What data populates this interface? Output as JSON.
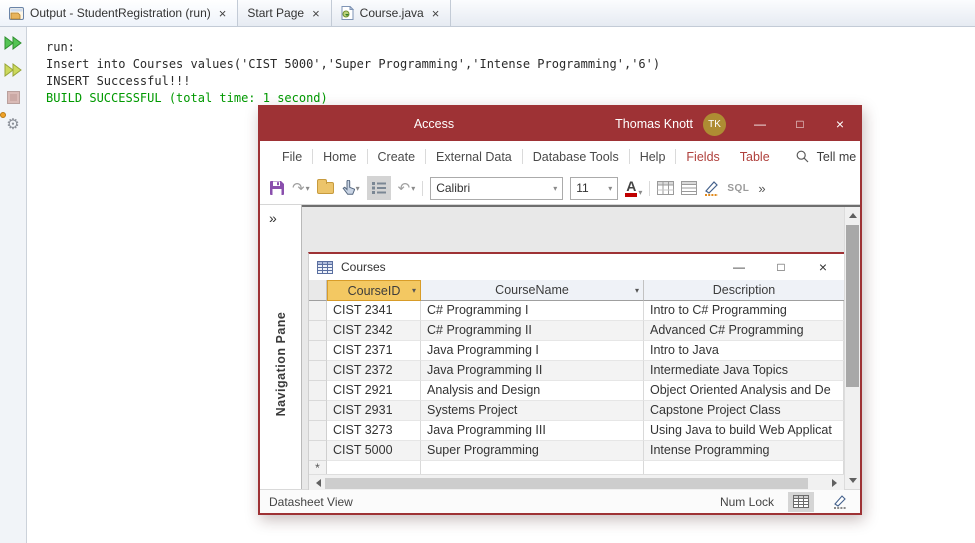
{
  "glyphs": {
    "tab_close": "×",
    "minimize": "—",
    "maximize": "□",
    "close": "×",
    "caret": "▾",
    "expand": "»",
    "more": "»",
    "redo": "↷",
    "undo": "↶",
    "gear": "⚙",
    "new_record": "*"
  },
  "netbeans": {
    "tabs": [
      {
        "label": "Output - StudentRegistration (run)"
      },
      {
        "label": "Start Page"
      },
      {
        "label": "Course.java"
      }
    ],
    "console": {
      "lines": [
        {
          "text": "run:"
        },
        {
          "text": "Insert into Courses values('CIST 5000','Super Programming','Intense Programming','6')"
        },
        {
          "text": "INSERT Successful!!!"
        },
        {
          "text": "BUILD SUCCESSFUL (total time: 1 second)"
        }
      ],
      "success_color": "#009900"
    }
  },
  "access": {
    "brand_color": "#9E3235",
    "titlebar": {
      "app_title": "Access",
      "user_name": "Thomas Knott",
      "avatar_initials": "TK"
    },
    "ribbon": {
      "tabs": [
        {
          "label": "File"
        },
        {
          "label": "Home"
        },
        {
          "label": "Create"
        },
        {
          "label": "External Data"
        },
        {
          "label": "Database Tools"
        },
        {
          "label": "Help"
        },
        {
          "label": "Fields",
          "accent": true
        },
        {
          "label": "Table",
          "accent": true
        }
      ],
      "accent_color": "#B0413D",
      "tell_me": "Tell me"
    },
    "toolbar": {
      "font_name": "Calibri",
      "font_size": "11",
      "sql_label": "SQL"
    },
    "nav_pane": {
      "label": "Navigation Pane"
    },
    "datasheet": {
      "window_title": "Courses",
      "columns": [
        {
          "label": "CourseID",
          "selected": true
        },
        {
          "label": "CourseName"
        },
        {
          "label": "Description"
        }
      ],
      "selected_header_color": "#F3C862",
      "rows": [
        {
          "id": "CIST 2341",
          "name": "C# Programming I",
          "desc": "Intro to C# Programming"
        },
        {
          "id": "CIST 2342",
          "name": "C# Programming II",
          "desc": "Advanced C# Programming"
        },
        {
          "id": "CIST 2371",
          "name": "Java Programming I",
          "desc": "Intro to Java"
        },
        {
          "id": "CIST 2372",
          "name": "Java Programming II",
          "desc": "Intermediate Java Topics"
        },
        {
          "id": "CIST 2921",
          "name": "Analysis and Design",
          "desc": "Object Oriented Analysis and De"
        },
        {
          "id": "CIST 2931",
          "name": "Systems Project",
          "desc": "Capstone Project Class"
        },
        {
          "id": "CIST 3273",
          "name": "Java Programming III",
          "desc": "Using Java to build Web Applicat"
        },
        {
          "id": "CIST 5000",
          "name": "Super Programming",
          "desc": "Intense Programming"
        }
      ]
    },
    "statusbar": {
      "view_label": "Datasheet View",
      "num_lock": "Num Lock"
    }
  }
}
